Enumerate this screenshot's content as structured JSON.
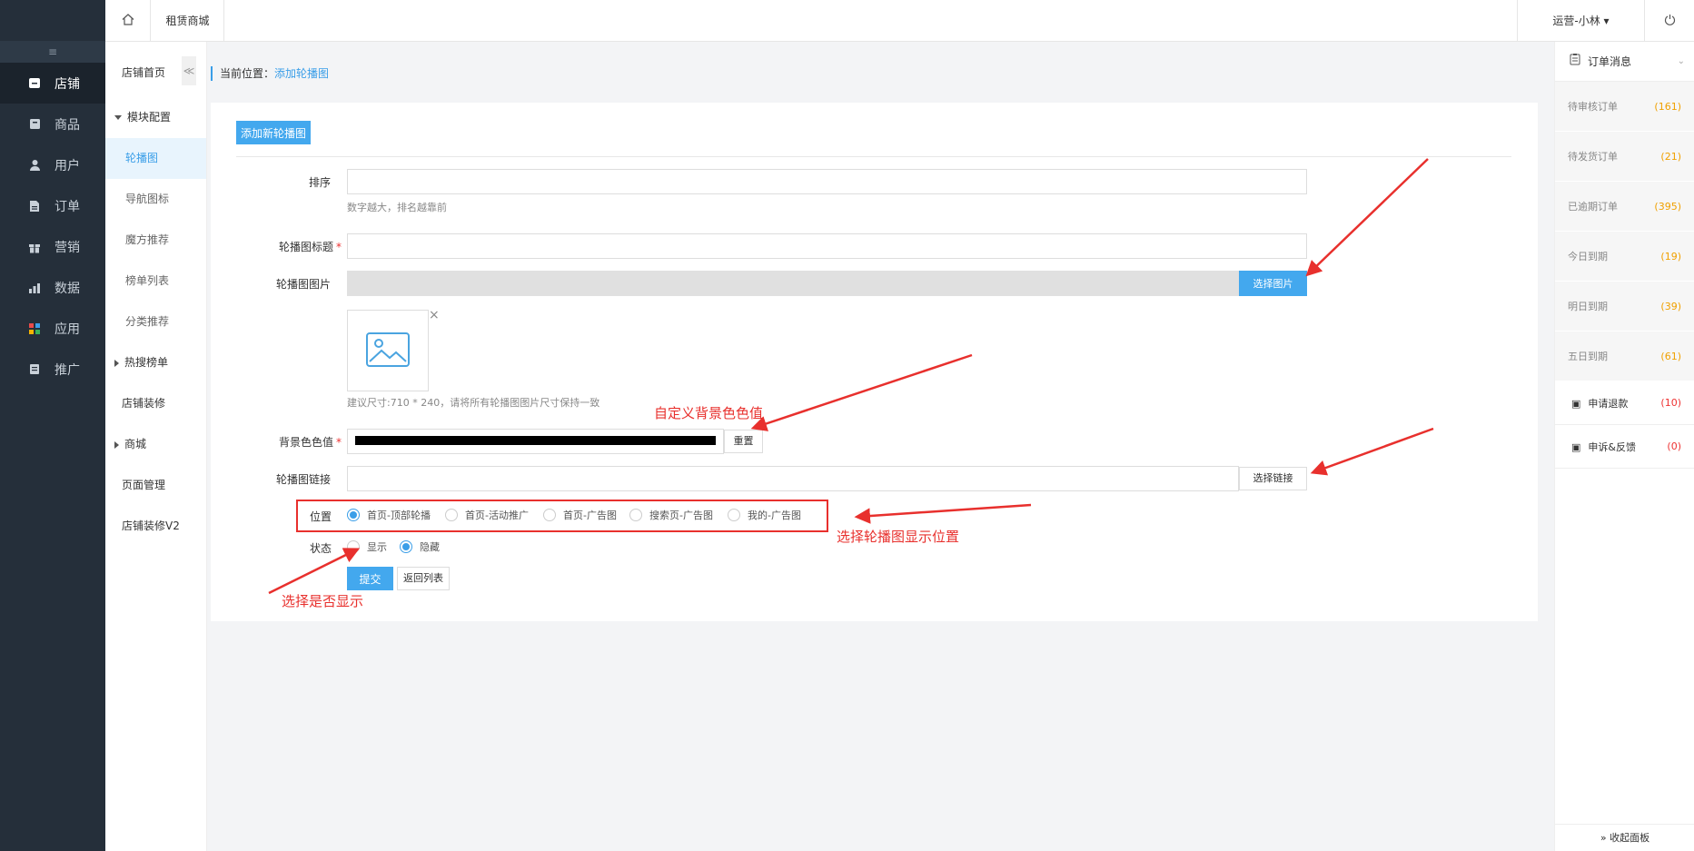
{
  "topbar": {
    "tab": "租赁商城",
    "user": "运营-小林 ▾"
  },
  "left_nav": {
    "collapse": "≡",
    "items": [
      {
        "label": "店铺",
        "icon": "shop-icon"
      },
      {
        "label": "商品",
        "icon": "goods-icon"
      },
      {
        "label": "用户",
        "icon": "user-icon"
      },
      {
        "label": "订单",
        "icon": "order-icon"
      },
      {
        "label": "营销",
        "icon": "gift-icon"
      },
      {
        "label": "数据",
        "icon": "chart-icon"
      },
      {
        "label": "应用",
        "icon": "apps-icon"
      },
      {
        "label": "推广",
        "icon": "promote-icon"
      }
    ]
  },
  "sub_nav": {
    "toggle": "≪",
    "items": [
      "店铺首页",
      "模块配置",
      "轮播图",
      "导航图标",
      "魔方推荐",
      "榜单列表",
      "分类推荐",
      "热搜榜单",
      "店铺装修",
      "商城",
      "页面管理",
      "店铺装修V2"
    ]
  },
  "breadcrumb": {
    "prefix": "当前位置：",
    "current": "添加轮播图"
  },
  "form": {
    "add_button": "添加新轮播图",
    "sort_label": "排序",
    "sort_hint": "数字越大，排名越靠前",
    "title_label": "轮播图标题",
    "image_label": "轮播图图片",
    "choose_image": "选择图片",
    "image_hint": "建议尺寸:710 * 240，请将所有轮播图图片尺寸保持一致",
    "bg_label": "背景色色值",
    "reset": "重置",
    "link_label": "轮播图链接",
    "choose_link": "选择链接",
    "position_label": "位置",
    "positions": [
      "首页-顶部轮播",
      "首页-活动推广",
      "首页-广告图",
      "搜索页-广告图",
      "我的-广告图"
    ],
    "status_label": "状态",
    "status_show": "显示",
    "status_hide": "隐藏",
    "submit": "提交",
    "back": "返回列表",
    "required_mark": "*",
    "remove_image": "×"
  },
  "annotations": {
    "bg_note": "自定义背景色色值",
    "position_note": "选择轮播图显示位置",
    "status_note": "选择是否显示"
  },
  "right_panel": {
    "title": "订单消息",
    "rows": [
      {
        "label": "待审核订单",
        "count": "(161)"
      },
      {
        "label": "待发货订单",
        "count": "(21)"
      },
      {
        "label": "已逾期订单",
        "count": "(395)"
      },
      {
        "label": "今日到期",
        "count": "(19)"
      },
      {
        "label": "明日到期",
        "count": "(39)"
      },
      {
        "label": "五日到期",
        "count": "(61)"
      }
    ],
    "rows2": [
      {
        "label": "申请退款",
        "count": "(10)"
      },
      {
        "label": "申诉&反馈",
        "count": "(0)"
      }
    ],
    "footer": "» 收起面板"
  },
  "colors": {
    "accent": "#43a8ee",
    "sidebar": "#252f3a",
    "annotation": "#e8302d"
  }
}
